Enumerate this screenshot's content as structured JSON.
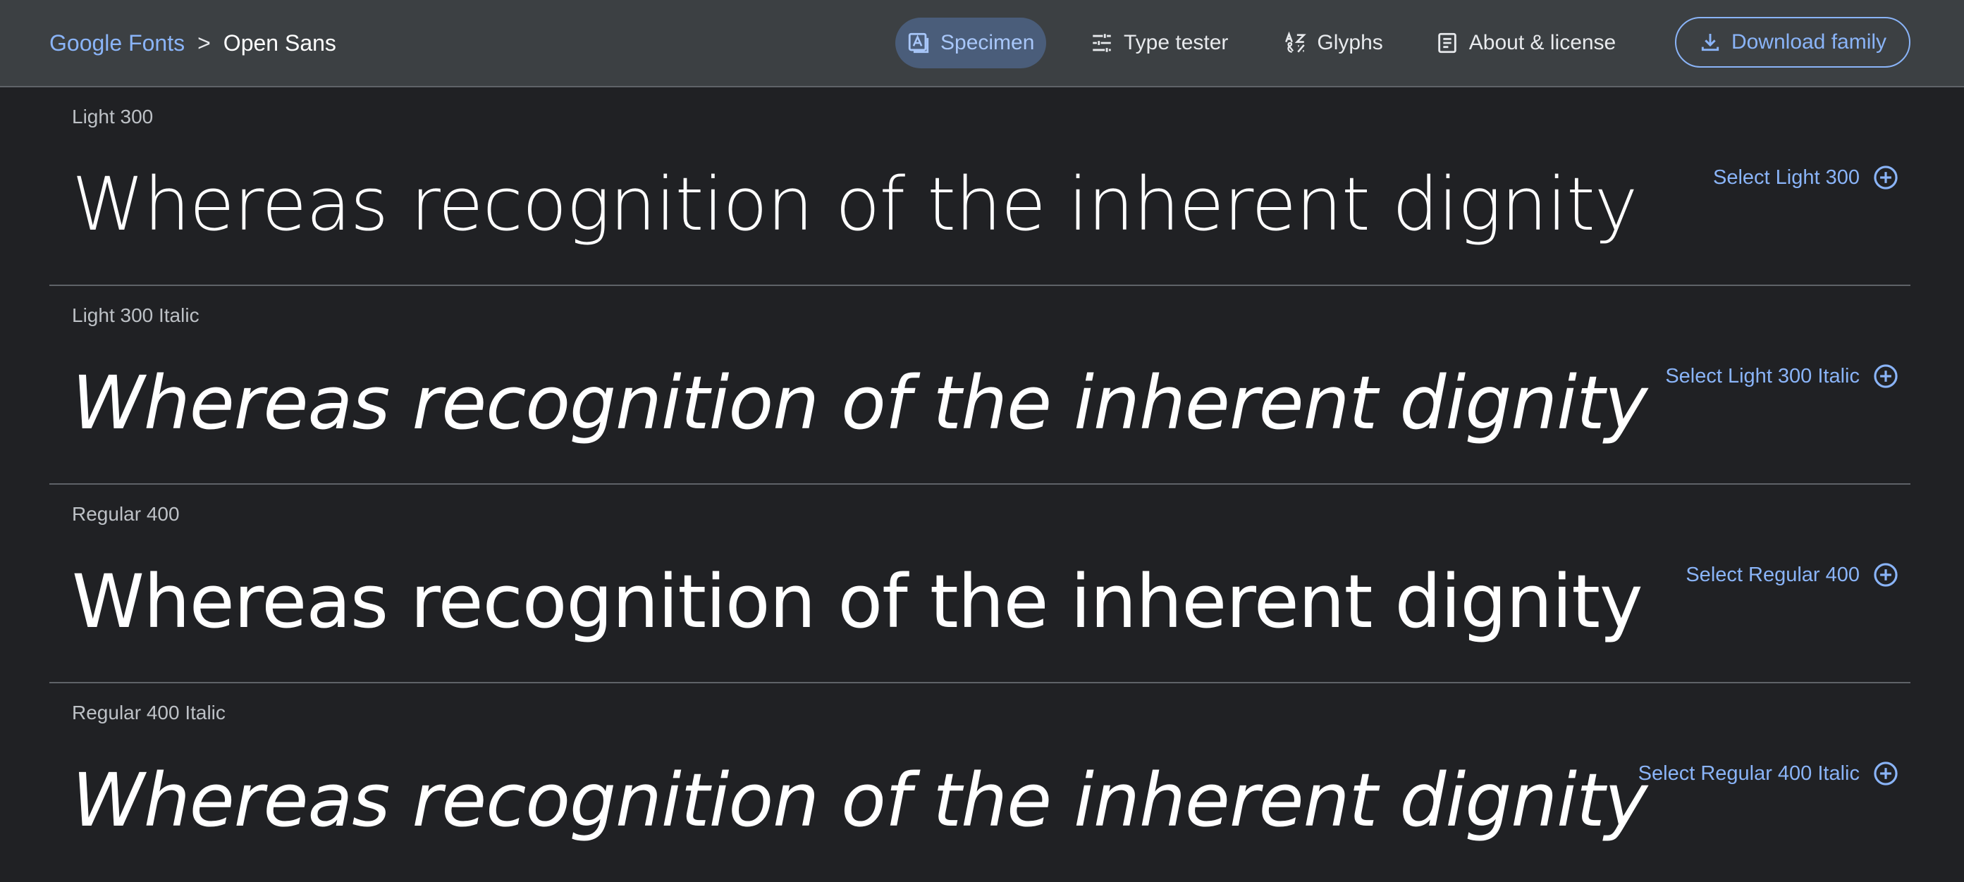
{
  "breadcrumb": {
    "root": "Google Fonts",
    "separator": ">",
    "current": "Open Sans"
  },
  "nav": {
    "specimen": "Specimen",
    "type_tester": "Type tester",
    "glyphs": "Glyphs",
    "about": "About & license",
    "download": "Download family"
  },
  "icons": {
    "specimen": "specimen-icon",
    "type_tester": "tune-icon",
    "glyphs": "glyphs-icon",
    "about": "article-icon",
    "download": "download-icon",
    "select": "add-circle-icon"
  },
  "colors": {
    "background": "#202124",
    "header": "#3c4043",
    "accent": "#8ab4f8",
    "active_tab": "#4a5d7a"
  },
  "styles": [
    {
      "label": "Light 300",
      "sample": "Whereas recognition of the inherent dignity",
      "select": "Select Light 300"
    },
    {
      "label": "Light 300 Italic",
      "sample": "Whereas recognition of the inherent dignity",
      "select": "Select Light 300 Italic"
    },
    {
      "label": "Regular 400",
      "sample": "Whereas recognition of the inherent dignity",
      "select": "Select Regular 400"
    },
    {
      "label": "Regular 400 Italic",
      "sample": "Whereas recognition of the inherent dignity",
      "select": "Select Regular 400 Italic"
    }
  ]
}
